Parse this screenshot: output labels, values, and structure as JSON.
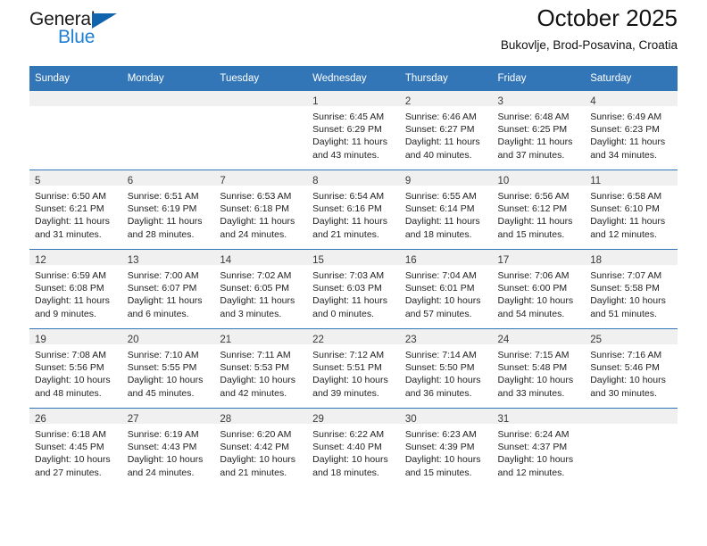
{
  "brand": {
    "name_top": "General",
    "name_bottom": "Blue",
    "triangle_color": "#1064ae",
    "blue_color": "#1f7fd4"
  },
  "header": {
    "title": "October 2025",
    "subtitle": "Bukovlje, Brod-Posavina, Croatia"
  },
  "theme": {
    "header_row_bg": "#3376b8",
    "daynum_bg": "#f0f0f0",
    "grid_line": "#3376b8",
    "text": "#222222"
  },
  "weekday_headers": [
    "Sunday",
    "Monday",
    "Tuesday",
    "Wednesday",
    "Thursday",
    "Friday",
    "Saturday"
  ],
  "weeks": [
    [
      {
        "empty": true
      },
      {
        "empty": true
      },
      {
        "empty": true
      },
      {
        "day": "1",
        "sunrise": "Sunrise: 6:45 AM",
        "sunset": "Sunset: 6:29 PM",
        "daylight1": "Daylight: 11 hours",
        "daylight2": "and 43 minutes."
      },
      {
        "day": "2",
        "sunrise": "Sunrise: 6:46 AM",
        "sunset": "Sunset: 6:27 PM",
        "daylight1": "Daylight: 11 hours",
        "daylight2": "and 40 minutes."
      },
      {
        "day": "3",
        "sunrise": "Sunrise: 6:48 AM",
        "sunset": "Sunset: 6:25 PM",
        "daylight1": "Daylight: 11 hours",
        "daylight2": "and 37 minutes."
      },
      {
        "day": "4",
        "sunrise": "Sunrise: 6:49 AM",
        "sunset": "Sunset: 6:23 PM",
        "daylight1": "Daylight: 11 hours",
        "daylight2": "and 34 minutes."
      }
    ],
    [
      {
        "day": "5",
        "sunrise": "Sunrise: 6:50 AM",
        "sunset": "Sunset: 6:21 PM",
        "daylight1": "Daylight: 11 hours",
        "daylight2": "and 31 minutes."
      },
      {
        "day": "6",
        "sunrise": "Sunrise: 6:51 AM",
        "sunset": "Sunset: 6:19 PM",
        "daylight1": "Daylight: 11 hours",
        "daylight2": "and 28 minutes."
      },
      {
        "day": "7",
        "sunrise": "Sunrise: 6:53 AM",
        "sunset": "Sunset: 6:18 PM",
        "daylight1": "Daylight: 11 hours",
        "daylight2": "and 24 minutes."
      },
      {
        "day": "8",
        "sunrise": "Sunrise: 6:54 AM",
        "sunset": "Sunset: 6:16 PM",
        "daylight1": "Daylight: 11 hours",
        "daylight2": "and 21 minutes."
      },
      {
        "day": "9",
        "sunrise": "Sunrise: 6:55 AM",
        "sunset": "Sunset: 6:14 PM",
        "daylight1": "Daylight: 11 hours",
        "daylight2": "and 18 minutes."
      },
      {
        "day": "10",
        "sunrise": "Sunrise: 6:56 AM",
        "sunset": "Sunset: 6:12 PM",
        "daylight1": "Daylight: 11 hours",
        "daylight2": "and 15 minutes."
      },
      {
        "day": "11",
        "sunrise": "Sunrise: 6:58 AM",
        "sunset": "Sunset: 6:10 PM",
        "daylight1": "Daylight: 11 hours",
        "daylight2": "and 12 minutes."
      }
    ],
    [
      {
        "day": "12",
        "sunrise": "Sunrise: 6:59 AM",
        "sunset": "Sunset: 6:08 PM",
        "daylight1": "Daylight: 11 hours",
        "daylight2": "and 9 minutes."
      },
      {
        "day": "13",
        "sunrise": "Sunrise: 7:00 AM",
        "sunset": "Sunset: 6:07 PM",
        "daylight1": "Daylight: 11 hours",
        "daylight2": "and 6 minutes."
      },
      {
        "day": "14",
        "sunrise": "Sunrise: 7:02 AM",
        "sunset": "Sunset: 6:05 PM",
        "daylight1": "Daylight: 11 hours",
        "daylight2": "and 3 minutes."
      },
      {
        "day": "15",
        "sunrise": "Sunrise: 7:03 AM",
        "sunset": "Sunset: 6:03 PM",
        "daylight1": "Daylight: 11 hours",
        "daylight2": "and 0 minutes."
      },
      {
        "day": "16",
        "sunrise": "Sunrise: 7:04 AM",
        "sunset": "Sunset: 6:01 PM",
        "daylight1": "Daylight: 10 hours",
        "daylight2": "and 57 minutes."
      },
      {
        "day": "17",
        "sunrise": "Sunrise: 7:06 AM",
        "sunset": "Sunset: 6:00 PM",
        "daylight1": "Daylight: 10 hours",
        "daylight2": "and 54 minutes."
      },
      {
        "day": "18",
        "sunrise": "Sunrise: 7:07 AM",
        "sunset": "Sunset: 5:58 PM",
        "daylight1": "Daylight: 10 hours",
        "daylight2": "and 51 minutes."
      }
    ],
    [
      {
        "day": "19",
        "sunrise": "Sunrise: 7:08 AM",
        "sunset": "Sunset: 5:56 PM",
        "daylight1": "Daylight: 10 hours",
        "daylight2": "and 48 minutes."
      },
      {
        "day": "20",
        "sunrise": "Sunrise: 7:10 AM",
        "sunset": "Sunset: 5:55 PM",
        "daylight1": "Daylight: 10 hours",
        "daylight2": "and 45 minutes."
      },
      {
        "day": "21",
        "sunrise": "Sunrise: 7:11 AM",
        "sunset": "Sunset: 5:53 PM",
        "daylight1": "Daylight: 10 hours",
        "daylight2": "and 42 minutes."
      },
      {
        "day": "22",
        "sunrise": "Sunrise: 7:12 AM",
        "sunset": "Sunset: 5:51 PM",
        "daylight1": "Daylight: 10 hours",
        "daylight2": "and 39 minutes."
      },
      {
        "day": "23",
        "sunrise": "Sunrise: 7:14 AM",
        "sunset": "Sunset: 5:50 PM",
        "daylight1": "Daylight: 10 hours",
        "daylight2": "and 36 minutes."
      },
      {
        "day": "24",
        "sunrise": "Sunrise: 7:15 AM",
        "sunset": "Sunset: 5:48 PM",
        "daylight1": "Daylight: 10 hours",
        "daylight2": "and 33 minutes."
      },
      {
        "day": "25",
        "sunrise": "Sunrise: 7:16 AM",
        "sunset": "Sunset: 5:46 PM",
        "daylight1": "Daylight: 10 hours",
        "daylight2": "and 30 minutes."
      }
    ],
    [
      {
        "day": "26",
        "sunrise": "Sunrise: 6:18 AM",
        "sunset": "Sunset: 4:45 PM",
        "daylight1": "Daylight: 10 hours",
        "daylight2": "and 27 minutes."
      },
      {
        "day": "27",
        "sunrise": "Sunrise: 6:19 AM",
        "sunset": "Sunset: 4:43 PM",
        "daylight1": "Daylight: 10 hours",
        "daylight2": "and 24 minutes."
      },
      {
        "day": "28",
        "sunrise": "Sunrise: 6:20 AM",
        "sunset": "Sunset: 4:42 PM",
        "daylight1": "Daylight: 10 hours",
        "daylight2": "and 21 minutes."
      },
      {
        "day": "29",
        "sunrise": "Sunrise: 6:22 AM",
        "sunset": "Sunset: 4:40 PM",
        "daylight1": "Daylight: 10 hours",
        "daylight2": "and 18 minutes."
      },
      {
        "day": "30",
        "sunrise": "Sunrise: 6:23 AM",
        "sunset": "Sunset: 4:39 PM",
        "daylight1": "Daylight: 10 hours",
        "daylight2": "and 15 minutes."
      },
      {
        "day": "31",
        "sunrise": "Sunrise: 6:24 AM",
        "sunset": "Sunset: 4:37 PM",
        "daylight1": "Daylight: 10 hours",
        "daylight2": "and 12 minutes."
      },
      {
        "empty": true
      }
    ]
  ]
}
